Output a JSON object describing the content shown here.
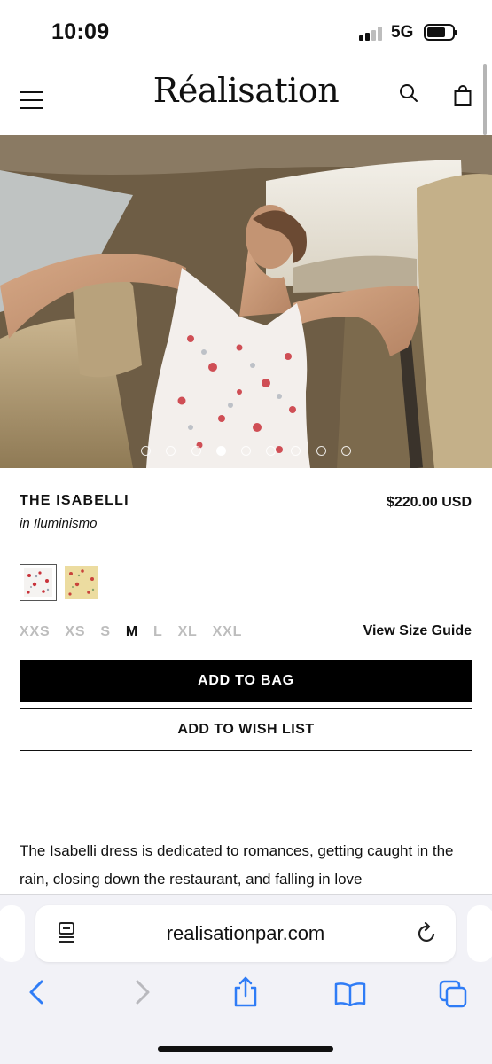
{
  "status_bar": {
    "time": "10:09",
    "network": "5G",
    "battery_percent": 75
  },
  "header": {
    "logo": "Réalisation",
    "menu_icon": "hamburger-menu-icon",
    "search_icon": "search-icon",
    "bag_icon": "shopping-bag-icon"
  },
  "hero": {
    "total_images": 9,
    "active_index": 4
  },
  "product": {
    "name": "THE ISABELLI",
    "collection": "in Iluminismo",
    "price": "$220.00 USD",
    "swatches": [
      {
        "name": "white-floral",
        "selected": true,
        "base": "#f5f3f1",
        "accent": "#c9333b"
      },
      {
        "name": "yellow-floral",
        "selected": false,
        "base": "#ecdca0",
        "accent": "#c9433b"
      }
    ],
    "sizes": [
      "XXS",
      "XS",
      "S",
      "M",
      "L",
      "XL",
      "XXL"
    ],
    "selected_size": "M",
    "size_guide": "View Size Guide",
    "add_to_bag": "ADD TO BAG",
    "add_to_wishlist": "ADD TO WISH LIST",
    "description": "The Isabelli dress is dedicated to romances, getting caught in the rain, closing down the restaurant, and falling in love"
  },
  "browser": {
    "url": "realisationpar.com",
    "reader_icon": "reader-mode-icon",
    "reload_icon": "reload-icon",
    "toolbar": [
      "back-icon",
      "forward-icon",
      "share-icon",
      "bookmarks-icon",
      "tabs-icon"
    ]
  },
  "colors": {
    "accent": "#000000",
    "text": "#111111",
    "muted": "#bdbdbd",
    "browser_blue": "#2f7cf6"
  }
}
